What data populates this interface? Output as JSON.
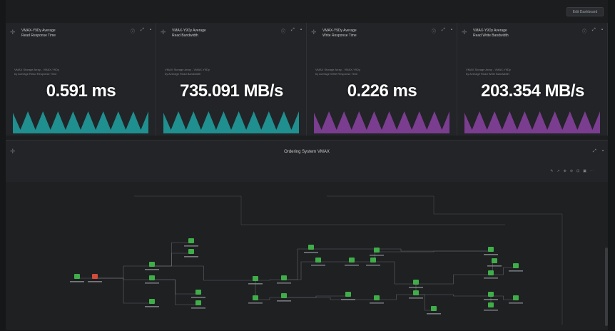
{
  "toolbar": {
    "edit_label": "Edit Dashboard"
  },
  "tiles": [
    {
      "title_line1": "VMAX-Y9Dy Average",
      "title_line2": "Read Response Time",
      "sub_line1": "VMAX Storage Array - VMAX-Y9Dy",
      "sub_line2": "by Average Read Response Time",
      "value": "0.591 ms",
      "color": "#1f8f8f"
    },
    {
      "title_line1": "VMAX-Y9Dy Average",
      "title_line2": "Read Bandwidth",
      "sub_line1": "VMAX Storage Array - VMAX-Y9Dy",
      "sub_line2": "by Average Read Bandwidth",
      "value": "735.091 MB/s",
      "color": "#1f8f8f"
    },
    {
      "title_line1": "VMAX-Y9Dy Average",
      "title_line2": "Write Response Time",
      "sub_line1": "VMAX Storage Array - VMAX-Y9Dy",
      "sub_line2": "by Average Write Response Time",
      "value": "0.226 ms",
      "color": "#7a3d8f"
    },
    {
      "title_line1": "VMAX-Y9Dy Average",
      "title_line2": "Read Write Bandwidth",
      "sub_line1": "VMAX Storage Array - VMAX-Y9Dy",
      "sub_line2": "by Average Read Write Bandwidth",
      "value": "203.354 MB/s",
      "color": "#7a3d8f"
    }
  ],
  "topology": {
    "title": "Ordering System VMAX",
    "colors": {
      "ok": "#3fae49",
      "error": "#d24a3a",
      "line": "#7b7f85"
    }
  }
}
